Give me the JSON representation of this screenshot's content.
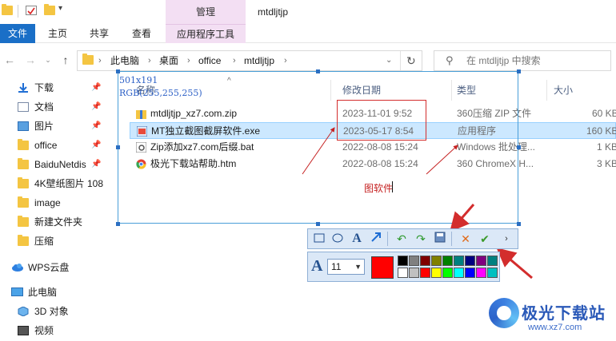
{
  "window": {
    "title": "mtdljtjp",
    "contextual_group": "管理"
  },
  "ribbon": {
    "tabs": [
      "文件",
      "主页",
      "共享",
      "查看"
    ],
    "contextual_tab": "应用程序工具"
  },
  "address": {
    "crumbs": [
      "此电脑",
      "桌面",
      "office",
      "mtdljtjp"
    ],
    "search_placeholder": "在 mtdljtjp 中搜索"
  },
  "sidebar": {
    "quick_access": [
      {
        "label": "下载",
        "icon": "download-arrow-icon",
        "pinned": true
      },
      {
        "label": "文档",
        "icon": "document-icon",
        "pinned": true
      },
      {
        "label": "图片",
        "icon": "picture-icon",
        "pinned": true
      },
      {
        "label": "office",
        "icon": "folder-icon",
        "pinned": true
      },
      {
        "label": "BaiduNetdis",
        "icon": "folder-icon",
        "pinned": true
      },
      {
        "label": "4K壁纸图片 108",
        "icon": "folder-icon",
        "pinned": false
      },
      {
        "label": "image",
        "icon": "folder-icon",
        "pinned": false
      },
      {
        "label": "新建文件夹",
        "icon": "folder-icon",
        "pinned": false
      },
      {
        "label": "压缩",
        "icon": "folder-icon",
        "pinned": false
      }
    ],
    "wps": "WPS云盘",
    "this_pc": "此电脑",
    "pc_items": [
      {
        "label": "3D 对象",
        "icon": "cube-3d-icon"
      },
      {
        "label": "视频",
        "icon": "video-icon"
      }
    ]
  },
  "filelist": {
    "columns": [
      "名称",
      "修改日期",
      "类型",
      "大小"
    ],
    "rows": [
      {
        "name": "mtdljtjp_xz7.com.zip",
        "date": "2023-11-01 9:52",
        "type": "360压缩 ZIP 文件",
        "size": "60 KB",
        "icon": "zip-archive-icon"
      },
      {
        "name": "MT独立截图截屏软件.exe",
        "date": "2023-05-17 8:54",
        "type": "应用程序",
        "size": "160 KB",
        "icon": "exe-app-icon"
      },
      {
        "name": "Zip添加xz7.com后缀.bat",
        "date": "2022-08-08 15:24",
        "type": "Windows 批处理...",
        "size": "1 KB",
        "icon": "bat-gear-icon"
      },
      {
        "name": "极光下载站帮助.htm",
        "date": "2022-08-08 15:24",
        "type": "360 ChromeX H...",
        "size": "3 KB",
        "icon": "chrome-htm-icon"
      }
    ]
  },
  "capture": {
    "dimensions": "501x191",
    "rgb": "RGB(255,255,255)",
    "annotation_text": "图软件"
  },
  "style_bar": {
    "font_size": "11",
    "current_color": "#ff0000",
    "palette": [
      "#000000",
      "#808080",
      "#800000",
      "#808000",
      "#008000",
      "#008080",
      "#000080",
      "#800080",
      "#008080",
      "#ffffff",
      "#c0c0c0",
      "#ff0000",
      "#ffff00",
      "#00ff00",
      "#00ffff",
      "#0000ff",
      "#ff00ff",
      "#00c0c0"
    ]
  },
  "watermark": {
    "name": "极光下载站",
    "url": "www.xz7.com"
  }
}
